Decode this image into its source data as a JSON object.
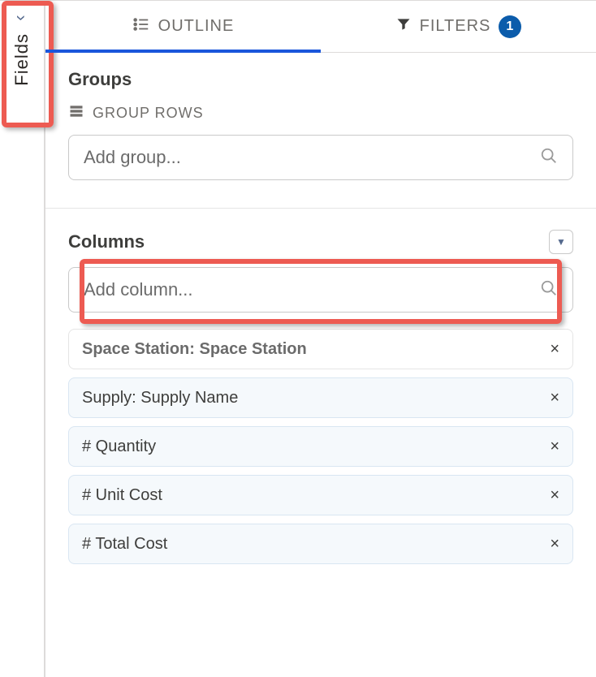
{
  "sidebar": {
    "label": "Fields"
  },
  "tabs": {
    "outline": {
      "label": "OUTLINE"
    },
    "filters": {
      "label": "FILTERS",
      "badge": "1"
    }
  },
  "groups": {
    "title": "Groups",
    "subheader": "GROUP ROWS",
    "add_placeholder": "Add group..."
  },
  "columns": {
    "title": "Columns",
    "add_placeholder": "Add column...",
    "items": [
      {
        "label": "Space Station: Space Station",
        "highlighted": true
      },
      {
        "label": "Supply: Supply Name"
      },
      {
        "label": "#  Quantity"
      },
      {
        "label": "#  Unit Cost"
      },
      {
        "label": "#  Total Cost"
      }
    ]
  }
}
